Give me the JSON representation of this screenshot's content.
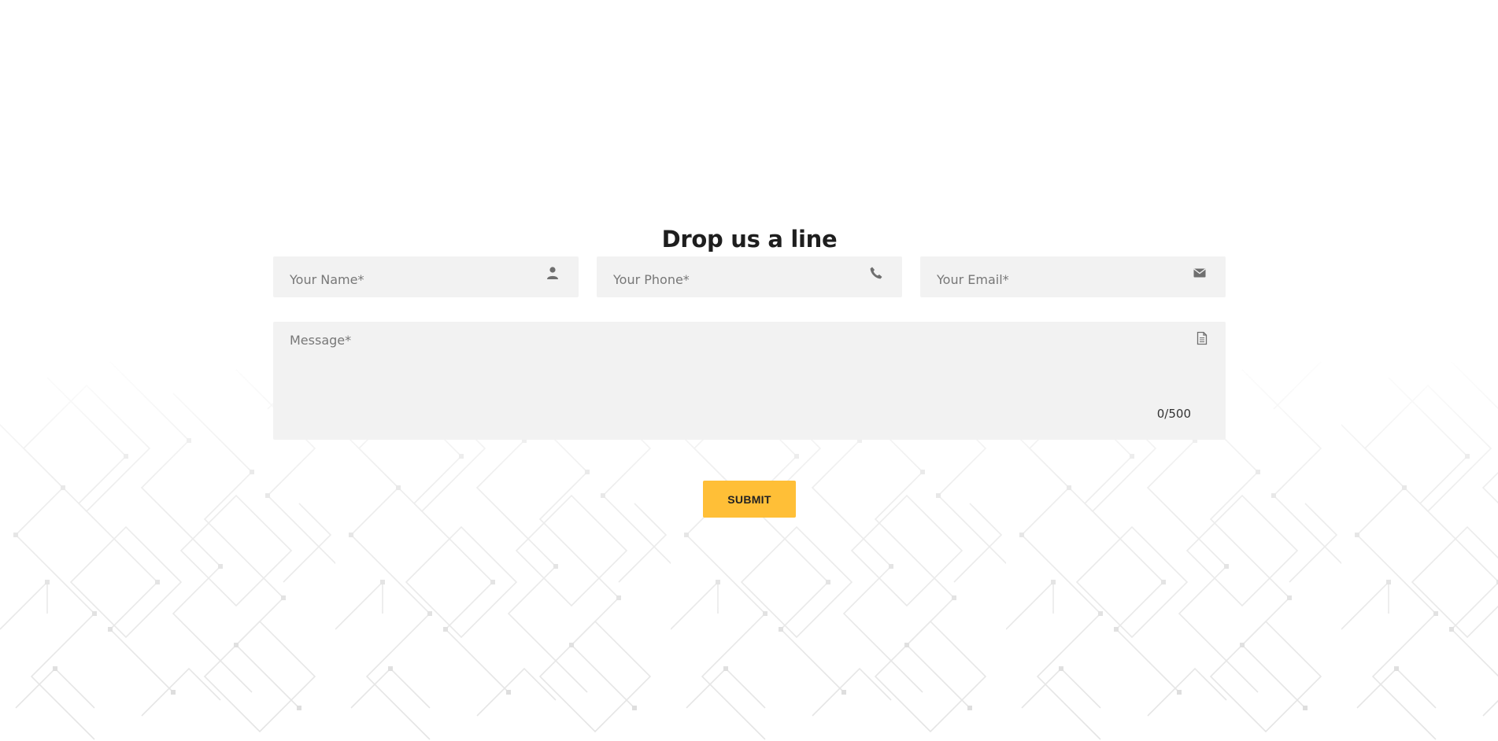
{
  "form": {
    "title": "Drop us a line",
    "name_placeholder": "Your Name*",
    "phone_placeholder": "Your Phone*",
    "email_placeholder": "Your Email*",
    "message_placeholder": "Message*",
    "counter": "0/500",
    "submit_label": "SUBMIT"
  },
  "icons": {
    "name": "user-icon",
    "phone": "phone-icon",
    "email": "envelope-icon",
    "message": "document-icon"
  },
  "colors": {
    "accent": "#ffbf37",
    "field_bg": "#f2f2f2",
    "pattern_line": "#e4e4e4"
  }
}
